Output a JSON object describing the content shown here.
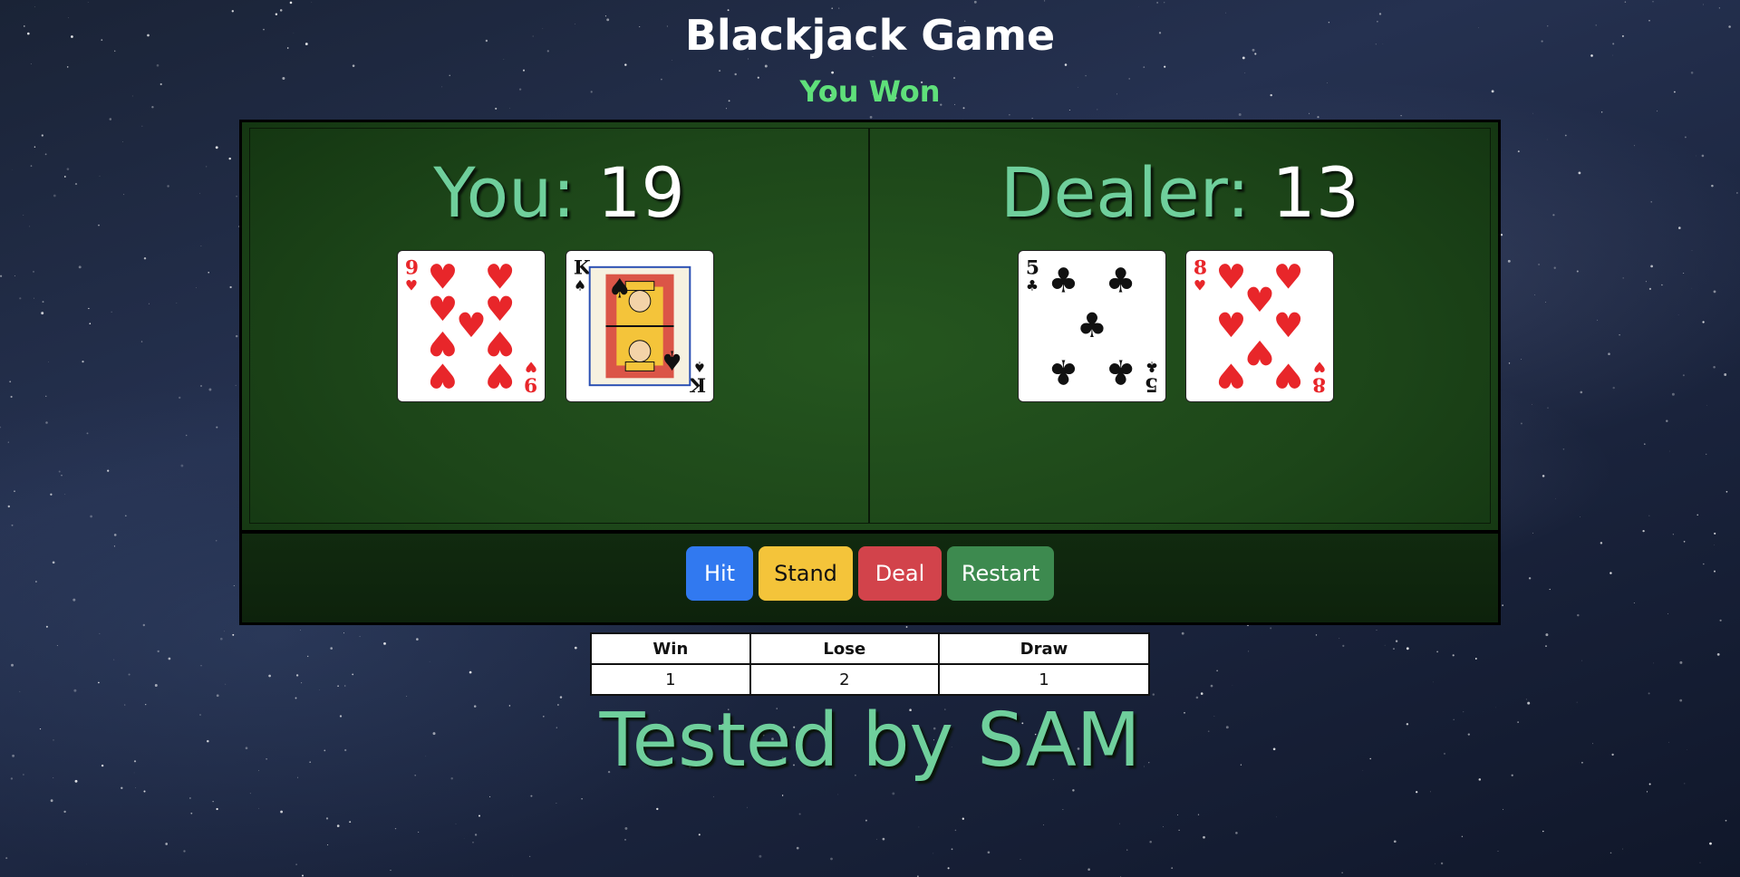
{
  "header": {
    "title": "Blackjack Game",
    "result_message": "You Won"
  },
  "player": {
    "label": "You:",
    "score": "19",
    "cards": [
      {
        "rank": "9",
        "suit": "hearts"
      },
      {
        "rank": "K",
        "suit": "spades"
      }
    ]
  },
  "dealer": {
    "label": "Dealer:",
    "score": "13",
    "cards": [
      {
        "rank": "5",
        "suit": "clubs"
      },
      {
        "rank": "8",
        "suit": "hearts"
      }
    ]
  },
  "controls": {
    "hit_label": "Hit",
    "stand_label": "Stand",
    "deal_label": "Deal",
    "restart_label": "Restart"
  },
  "stats": {
    "headers": [
      "Win",
      "Lose",
      "Draw"
    ],
    "values": [
      "1",
      "2",
      "1"
    ]
  },
  "footer": {
    "text": "Tested by SAM"
  },
  "colors": {
    "result": "#5fe07a",
    "score_label": "#6fcf9c",
    "hit": "#3179f0",
    "stand": "#f4c43a",
    "deal": "#d2434b",
    "restart": "#3d8a4f",
    "red_suit": "#e8262a",
    "black_suit": "#111111"
  }
}
